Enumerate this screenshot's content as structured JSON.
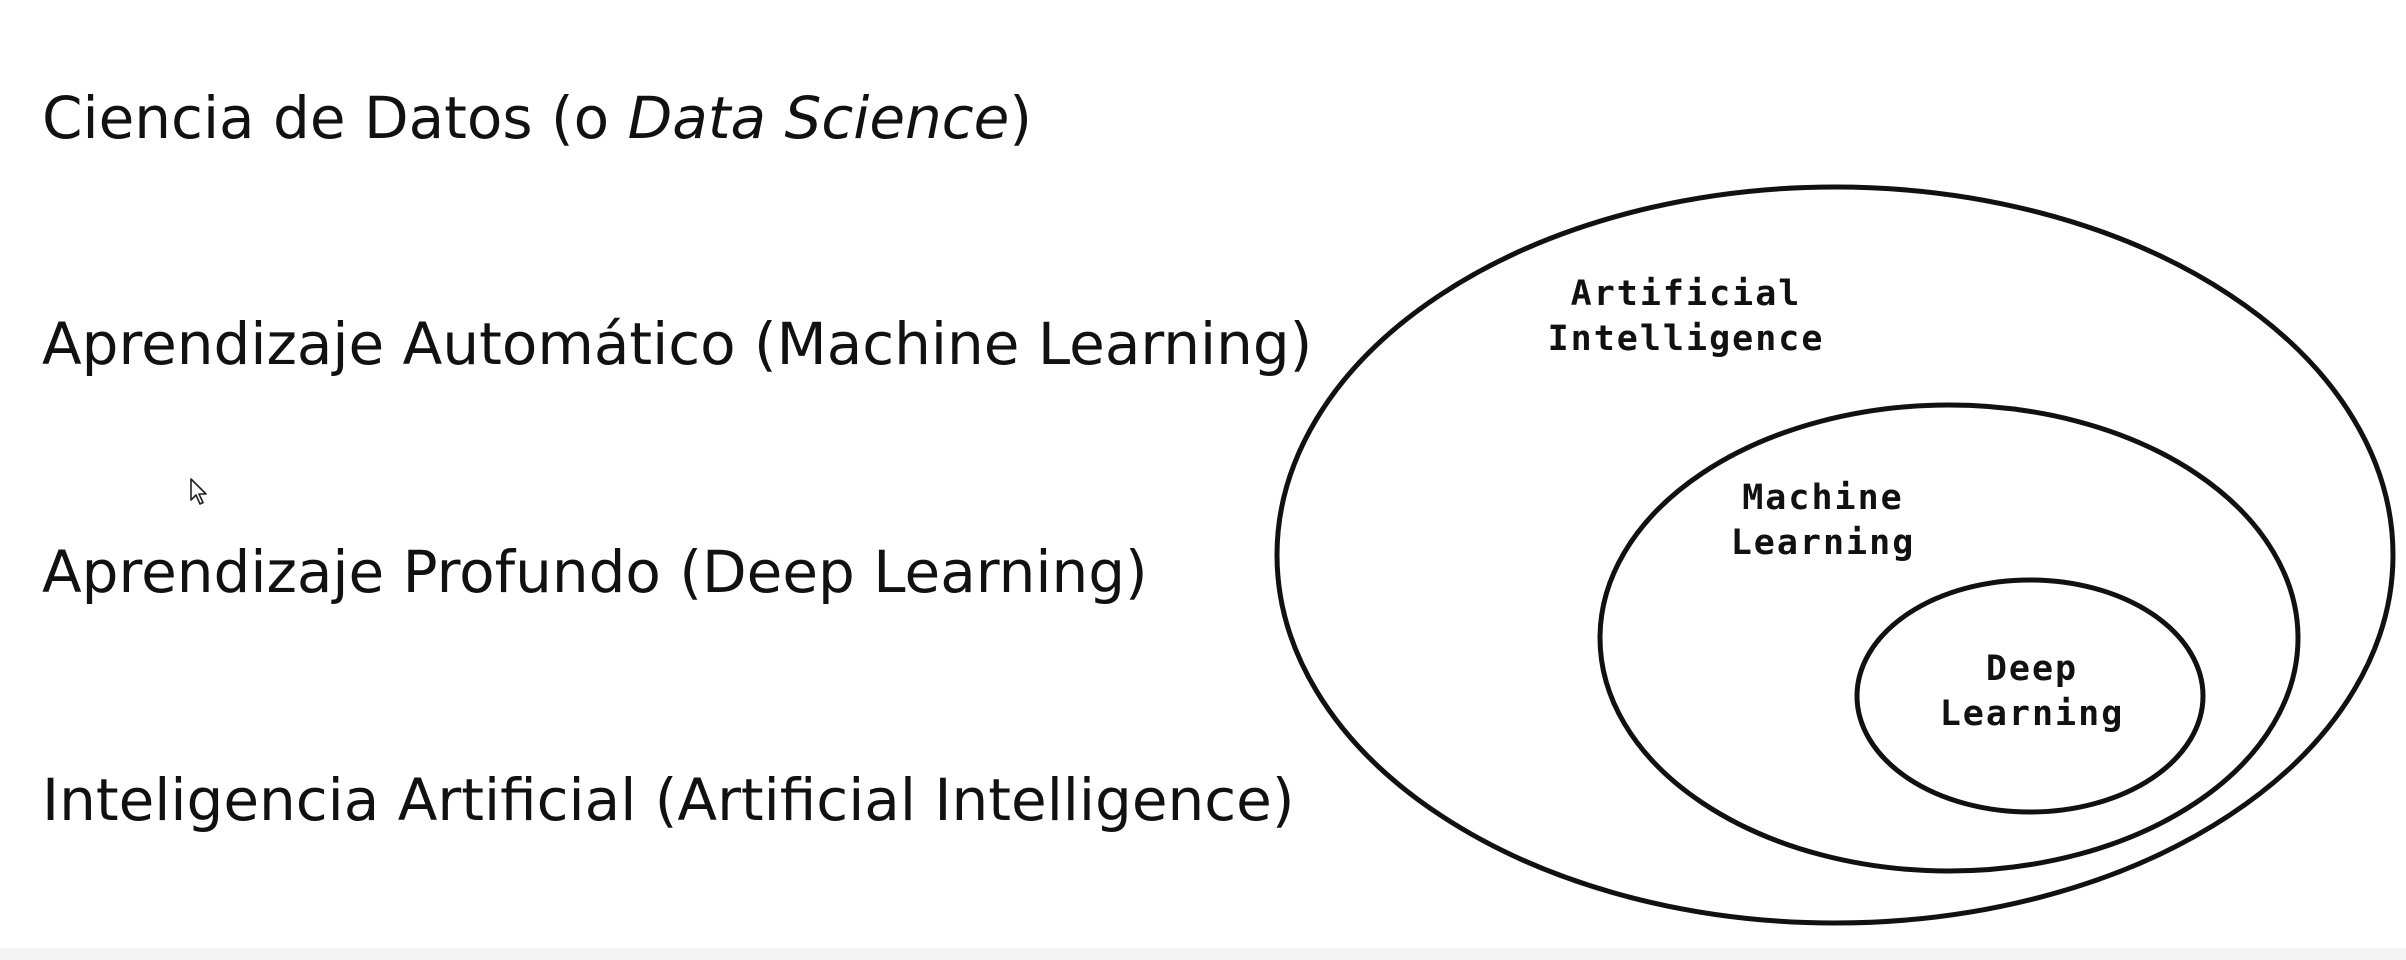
{
  "slide": {
    "lines": [
      {
        "prefix": "Ciencia de Datos (o ",
        "emphasis": "Data Science",
        "suffix": ")"
      },
      {
        "text": "Aprendizaje Automático (Machine Learning)"
      },
      {
        "text": "Aprendizaje Profundo (Deep Learning)"
      },
      {
        "text": "Inteligencia Artificial (Artificial Intelligence)"
      }
    ]
  },
  "diagram": {
    "outer": {
      "line1": "Artificial",
      "line2": "Intelligence"
    },
    "middle": {
      "line1": "Machine",
      "line2": "Learning"
    },
    "inner": {
      "line1": "Deep",
      "line2": "Learning"
    },
    "stroke_color": "#111111"
  }
}
